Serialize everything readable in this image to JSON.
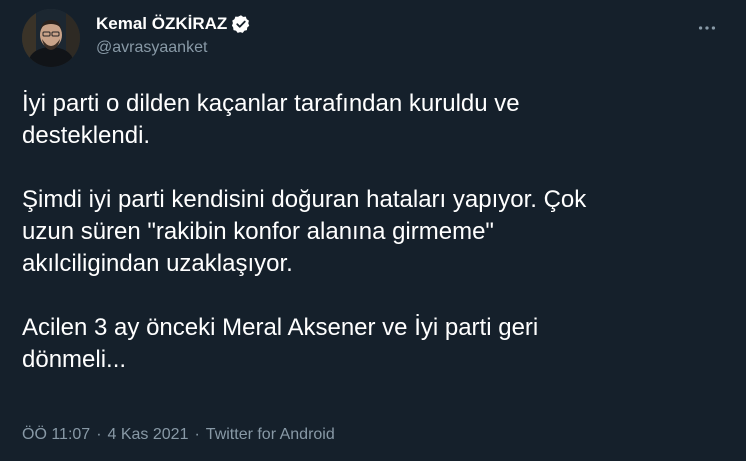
{
  "author": {
    "display_name": "Kemal ÖZKİRAZ",
    "handle": "@avrasyaanket",
    "avatar_icon": "profile-photo",
    "verified_icon": "verified-badge-icon"
  },
  "tweet": {
    "paragraphs": [
      "İyi parti o dilden kaçanlar tarafından kuruldu ve\ndesteklendi.",
      "Şimdi iyi parti kendisini doğuran hataları yapıyor. Çok\nuzun süren \"rakibin konfor alanına girmeme\"\nakılciligindan uzaklaşıyor.",
      "Acilen 3 ay önceki Meral Aksener ve İyi parti geri\ndönmeli..."
    ]
  },
  "meta": {
    "time": "ÖÖ 11:07",
    "date": "4 Kas 2021",
    "source": "Twitter for Android",
    "separator": "·"
  },
  "colors": {
    "background": "#15202b",
    "text_primary": "#ffffff",
    "text_secondary": "#8899a6",
    "verified": "#ffffff"
  }
}
